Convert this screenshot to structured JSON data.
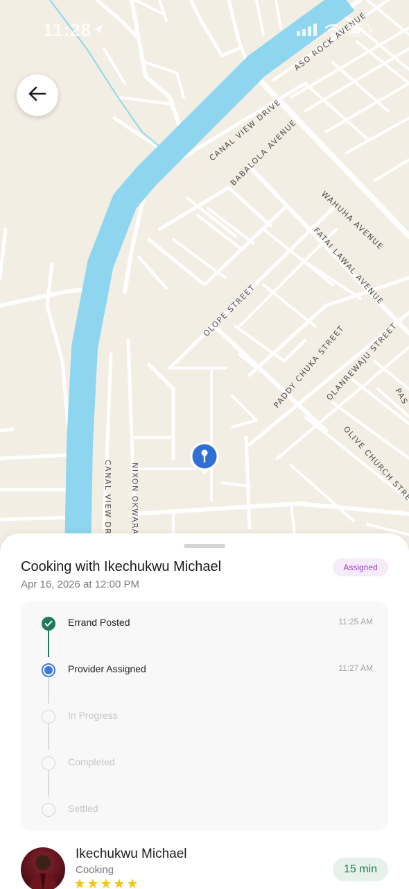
{
  "status_bar": {
    "time": "11:28"
  },
  "map": {
    "street_labels": {
      "aso_rock": "ASO ROCK AVENUE",
      "canal_view_drive_ne": "CANAL VIEW DRIVE",
      "babalola": "BABALOLA AVENUE",
      "wahuha": "WAHUHA AVENUE",
      "fatai_lawal": "FATAI LAWAL AVENUE",
      "olope": "OLOPE STREET",
      "paddy_chuka": "PADDY CHUKA STREET",
      "olanrewaju": "OLANREWAJU STREET",
      "olive_church": "OLIVE CHURCH STRE",
      "pas": "PAS",
      "canal_view_drive_sw": "CANAL VIEW DRI",
      "nixon_okwara": "NIXON OKWARA"
    }
  },
  "errand": {
    "title": "Cooking with Ikechukwu Michael",
    "date": "Apr 16, 2026 at 12:00 PM",
    "status": "Assigned"
  },
  "timeline": {
    "steps": [
      {
        "label": "Errand Posted",
        "time": "11:25 AM"
      },
      {
        "label": "Provider Assigned",
        "time": "11:27 AM"
      },
      {
        "label": "In Progress",
        "time": ""
      },
      {
        "label": "Completed",
        "time": ""
      },
      {
        "label": "Settled",
        "time": ""
      }
    ]
  },
  "provider": {
    "name": "Ikechukwu Michael",
    "role": "Cooking",
    "rating": 5,
    "eta": "15 min"
  },
  "colors": {
    "map_background": "#f3eee3",
    "canal": "#8ed6ef",
    "done": "#1e7a5a",
    "current": "#3d78e0",
    "badge_text": "#9c3fbf",
    "star": "#f5c518"
  },
  "icons": {
    "back": "arrow-left-icon",
    "pin": "map-pin-icon",
    "check": "check-icon",
    "star": "star-icon"
  }
}
